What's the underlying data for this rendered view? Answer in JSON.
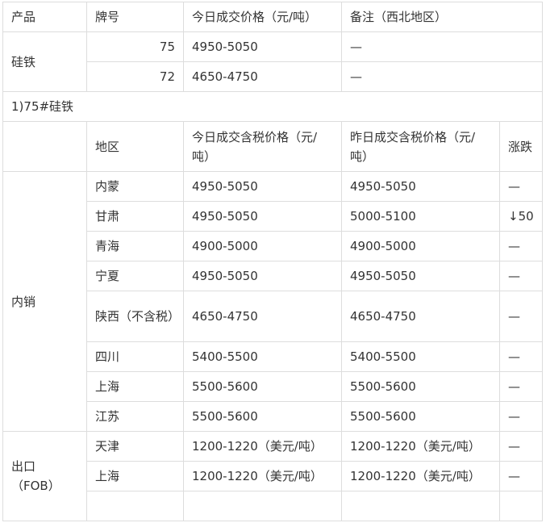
{
  "table1": {
    "headers": [
      "产品",
      "牌号",
      "今日成交价格（元/吨）",
      "备注（西北地区）"
    ],
    "product": "硅铁",
    "rows": [
      {
        "grade": "75",
        "price": "4950-5050",
        "remark": "—"
      },
      {
        "grade": "72",
        "price": "4650-4750",
        "remark": "—"
      }
    ]
  },
  "section_label": "1)75#硅铁",
  "table2": {
    "headers": [
      "",
      "地区",
      "今日成交含税价格（元/吨）",
      "昨日成交含税价格（元/吨）",
      "涨跌"
    ],
    "domestic_label": "内销",
    "domestic_rows": [
      {
        "region": "内蒙",
        "today": "4950-5050",
        "yesterday": "4950-5050",
        "change": "—"
      },
      {
        "region": "甘肃",
        "today": "4950-5050",
        "yesterday": "5000-5100",
        "change": "↓50"
      },
      {
        "region": "青海",
        "today": "4900-5000",
        "yesterday": "4900-5000",
        "change": "—"
      },
      {
        "region": "宁夏",
        "today": "4950-5050",
        "yesterday": "4950-5050",
        "change": "—"
      },
      {
        "region": "陕西（不含税）",
        "today": "4650-4750",
        "yesterday": "4650-4750",
        "change": "—"
      },
      {
        "region": "四川",
        "today": "5400-5500",
        "yesterday": "5400-5500",
        "change": "—"
      },
      {
        "region": "上海",
        "today": "5500-5600",
        "yesterday": "5500-5600",
        "change": "—"
      },
      {
        "region": "江苏",
        "today": "5500-5600",
        "yesterday": "5500-5600",
        "change": "—"
      }
    ],
    "export_label": "出口（FOB）",
    "export_rows": [
      {
        "region": "天津",
        "today": "1200-1220（美元/吨）",
        "yesterday": "1200-1220（美元/吨）",
        "change": "—"
      },
      {
        "region": "上海",
        "today": "1200-1220（美元/吨）",
        "yesterday": "1200-1220（美元/吨）",
        "change": "—"
      }
    ]
  }
}
